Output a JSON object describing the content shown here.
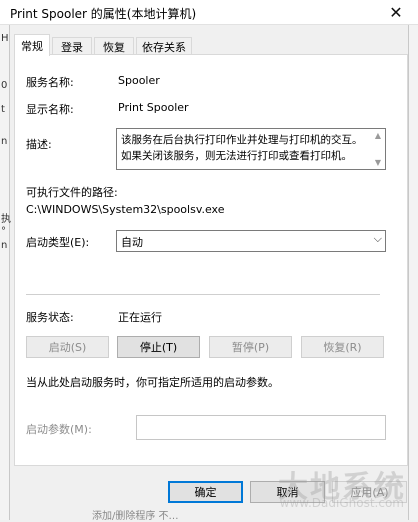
{
  "window": {
    "title": "Print Spooler 的属性(本地计算机)",
    "close_glyph": "✕"
  },
  "background": {
    "left_chars": [
      "H",
      "0",
      "t",
      "n",
      "执",
      "°",
      "n"
    ],
    "bottom_text": "添加/删除程序  不…"
  },
  "tabs": [
    {
      "label": "常规",
      "active": true
    },
    {
      "label": "登录",
      "active": false
    },
    {
      "label": "恢复",
      "active": false
    },
    {
      "label": "依存关系",
      "active": false
    }
  ],
  "general": {
    "service_name_label": "服务名称:",
    "service_name": "Spooler",
    "display_name_label": "显示名称:",
    "display_name": "Print Spooler",
    "description_label": "描述:",
    "description": "该服务在后台执行打印作业并处理与打印机的交互。如果关闭该服务，则无法进行打印或查看打印机。",
    "exe_path_label": "可执行文件的路径:",
    "exe_path": "C:\\WINDOWS\\System32\\spoolsv.exe",
    "startup_type_label": "启动类型(E):",
    "startup_type": "自动",
    "status_label": "服务状态:",
    "status": "正在运行",
    "buttons": {
      "start": "启动(S)",
      "stop": "停止(T)",
      "pause": "暂停(P)",
      "resume": "恢复(R)"
    },
    "hint": "当从此处启动服务时，你可指定所适用的启动参数。",
    "params_label": "启动参数(M):",
    "params_value": ""
  },
  "footer": {
    "ok": "确定",
    "cancel": "取消",
    "apply": "应用(A)"
  },
  "watermark": {
    "main": "大地系统",
    "sub": "www.DadiGhost.com"
  }
}
